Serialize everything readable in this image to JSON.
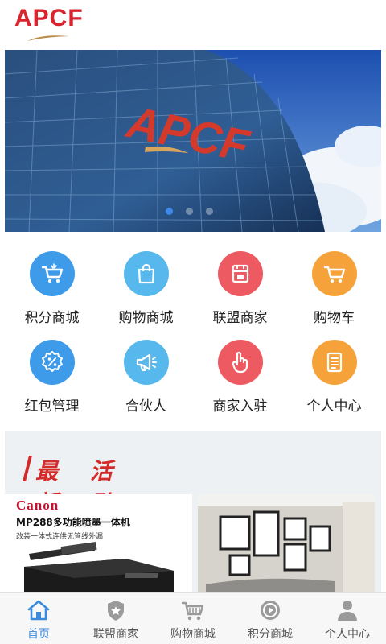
{
  "header": {
    "logo_text": "APCF"
  },
  "banner": {
    "sign_text": "APCF",
    "slide_count": 3,
    "active_slide": 1
  },
  "grid": {
    "items": [
      {
        "label": "积分商城",
        "icon": "cart-icon",
        "color": "#3d9be9"
      },
      {
        "label": "购物商城",
        "icon": "bag-icon",
        "color": "#56b8ec"
      },
      {
        "label": "联盟商家",
        "icon": "store-icon",
        "color": "#ee5a61"
      },
      {
        "label": "购物车",
        "icon": "cart-icon",
        "color": "#f6a23a"
      },
      {
        "label": "红包管理",
        "icon": "percent-icon",
        "color": "#3d9be9"
      },
      {
        "label": "合伙人",
        "icon": "megaphone-icon",
        "color": "#56b8ec"
      },
      {
        "label": "商家入驻",
        "icon": "hand-icon",
        "color": "#ee5a61"
      },
      {
        "label": "个人中心",
        "icon": "document-icon",
        "color": "#f6a23a"
      }
    ]
  },
  "activity": {
    "title_part1": "最新",
    "title_part2": "活动",
    "promo_left": {
      "brand": "Canon",
      "model": "MP288多功能喷墨一体机",
      "subtitle": "改装一体式连供无管线外漏"
    }
  },
  "tabbar": {
    "tabs": [
      {
        "label": "首页",
        "icon": "home-icon",
        "active": true
      },
      {
        "label": "联盟商家",
        "icon": "shield-star-icon",
        "active": false
      },
      {
        "label": "购物商城",
        "icon": "cart-icon",
        "active": false
      },
      {
        "label": "积分商城",
        "icon": "play-badge-icon",
        "active": false
      },
      {
        "label": "个人中心",
        "icon": "user-icon",
        "active": false
      }
    ]
  },
  "colors": {
    "accent": "#3a8be0",
    "brand_red": "#d9232d",
    "inactive_tab": "#9a9a9a"
  }
}
